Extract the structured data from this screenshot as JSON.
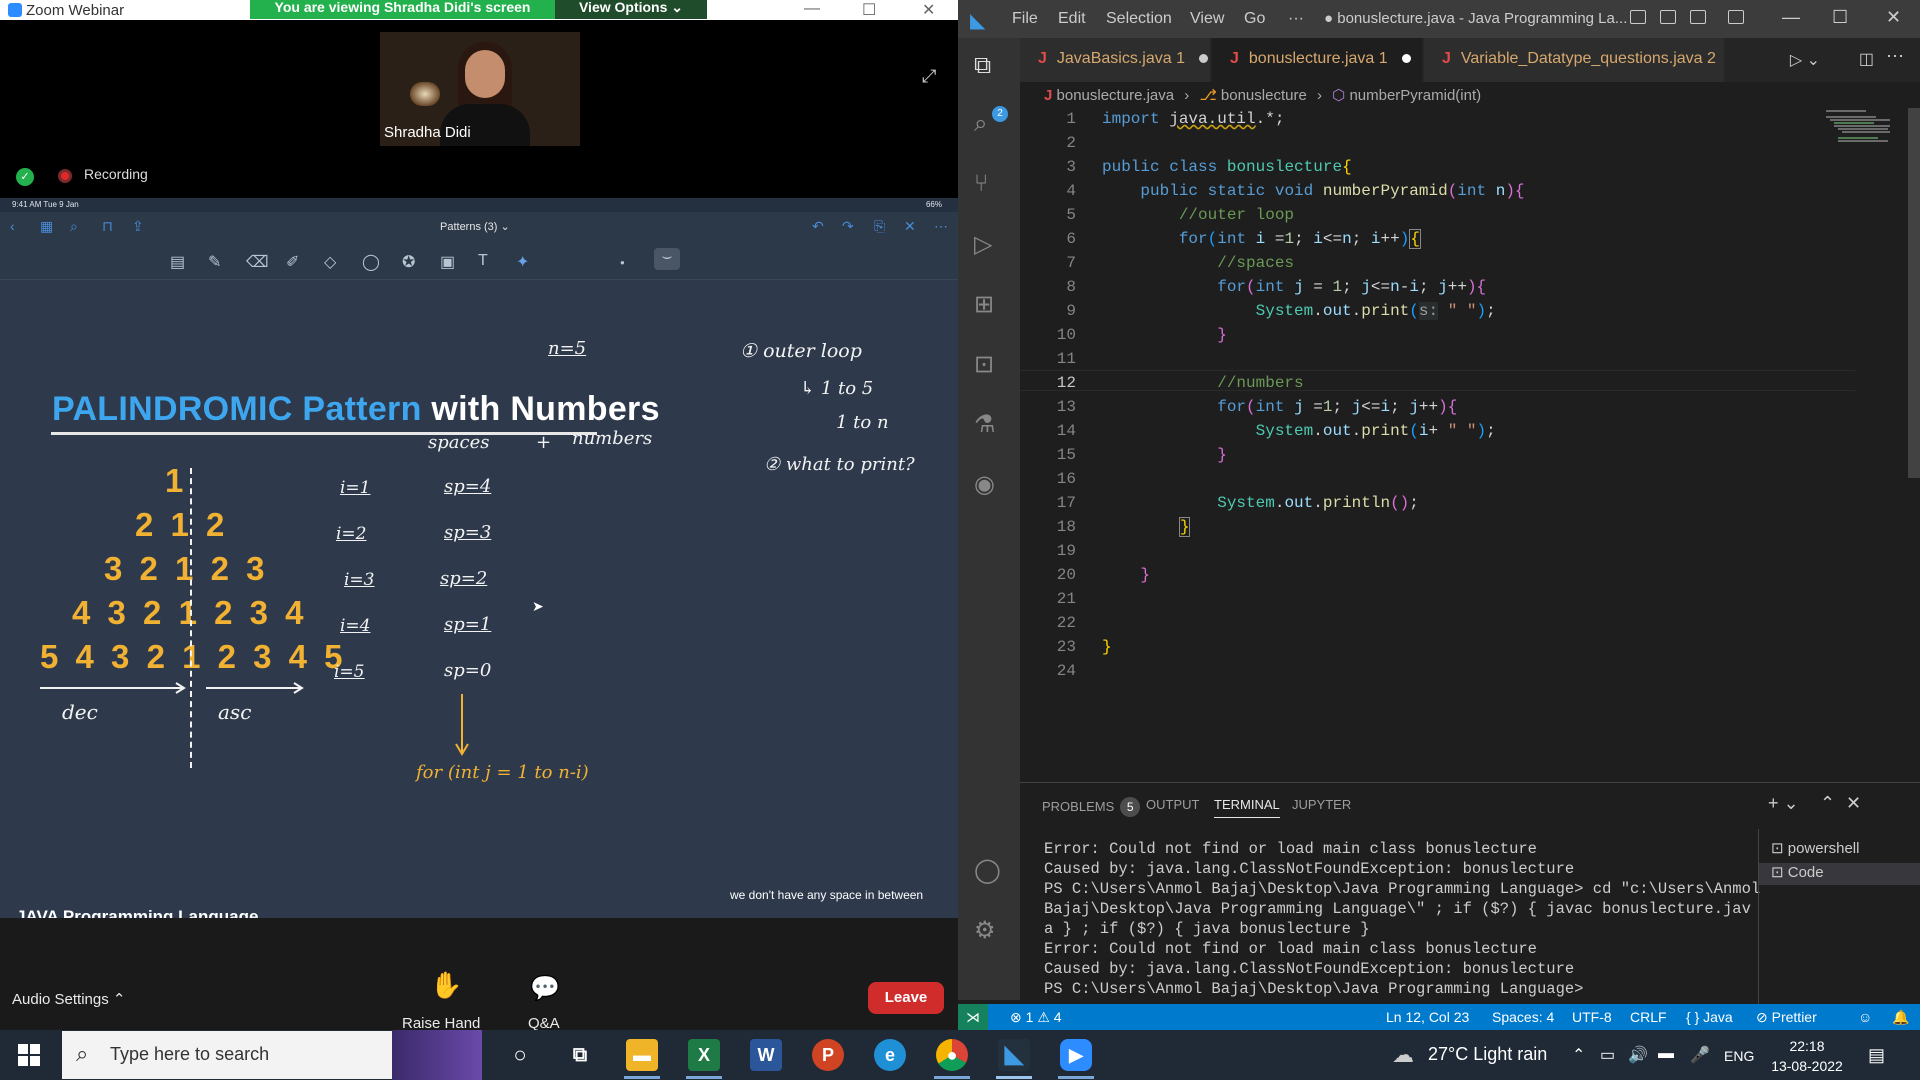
{
  "zoom": {
    "title": "Zoom Webinar",
    "banner": "You are viewing Shradha Didi's screen",
    "view_options": "View Options",
    "speaker_name": "Shradha Didi",
    "recording": "Recording",
    "ipad": {
      "status_time": "9:41 AM  Tue 9 Jan",
      "status_battery": "66%",
      "doc_title": "Patterns (3)",
      "title_part1": "PALINDROMIC Pattern",
      "title_part2": "with Numbers",
      "pyramid_rows": [
        "1",
        "2 1 2",
        "3 2 1 2 3",
        "4 3 2 1 2 3 4",
        "5 4 3 2 1 2 3 4 5"
      ],
      "notes": {
        "n_eq": "n=5",
        "outer_loop": "① outer loop",
        "one_to_5": "1 to 5",
        "one_to_n": "1 to n",
        "what_to_print": "② what to print?",
        "spaces": "spaces",
        "plus": "+",
        "numbers": "numbers",
        "dec": "dec",
        "asc": "asc",
        "for_loop": "for (int j = 1 to n-i)",
        "i_values": [
          "i=1",
          "i=2",
          "i=3",
          "i=4",
          "i=5"
        ],
        "sp_values": [
          "sp=4",
          "sp=3",
          "sp=2",
          "sp=1",
          "sp=0"
        ]
      },
      "course_label": "JAVA Programming Language",
      "caption": "we don't have any space in between"
    },
    "controls": {
      "audio_settings": "Audio Settings",
      "raise_hand": "Raise Hand",
      "qa": "Q&A",
      "leave": "Leave"
    }
  },
  "vscode": {
    "menu": [
      "File",
      "Edit",
      "Selection",
      "View",
      "Go",
      "···"
    ],
    "title": "● bonuslecture.java - Java Programming La...",
    "tabs": [
      {
        "label": "JavaBasics.java",
        "badge": "1"
      },
      {
        "label": "bonuslecture.java",
        "badge": "1"
      },
      {
        "label": "Variable_Datatype_questions.java",
        "badge": "2"
      }
    ],
    "breadcrumb": [
      "bonuslecture.java",
      "bonuslecture",
      "numberPyramid(int)"
    ],
    "explorer_badge": "2",
    "line_numbers": [
      "1",
      "2",
      "3",
      "4",
      "5",
      "6",
      "7",
      "8",
      "9",
      "10",
      "11",
      "12",
      "13",
      "14",
      "15",
      "16",
      "17",
      "18",
      "19",
      "20",
      "21",
      "22",
      "23",
      "24"
    ],
    "active_line": 12,
    "panel_tabs": {
      "problems": "PROBLEMS",
      "problems_count": "5",
      "output": "OUTPUT",
      "terminal": "TERMINAL",
      "jupyter": "JUPYTER"
    },
    "terminal_lines": [
      "Error: Could not find or load main class bonuslecture",
      "Caused by: java.lang.ClassNotFoundException: bonuslecture",
      "PS C:\\Users\\Anmol Bajaj\\Desktop\\Java Programming Language> cd \"c:\\Users\\Anmol",
      " Bajaj\\Desktop\\Java Programming Language\\\" ; if ($?) { javac bonuslecture.jav",
      "a } ; if ($?) { java bonuslecture }",
      "Error: Could not find or load main class bonuslecture",
      "Caused by: java.lang.ClassNotFoundException: bonuslecture",
      "PS C:\\Users\\Anmol Bajaj\\Desktop\\Java Programming Language> "
    ],
    "terminal_list": [
      "powershell",
      "Code"
    ],
    "status": {
      "errors": "1",
      "warnings": "4",
      "position": "Ln 12, Col 23",
      "spaces": "Spaces: 4",
      "encoding": "UTF-8",
      "eol": "CRLF",
      "language": "{ } Java",
      "prettier": "Prettier"
    }
  },
  "taskbar": {
    "search_placeholder": "Type here to search",
    "weather": "27°C  Light rain",
    "language": "ENG",
    "time": "22:18",
    "date": "13-08-2022"
  }
}
